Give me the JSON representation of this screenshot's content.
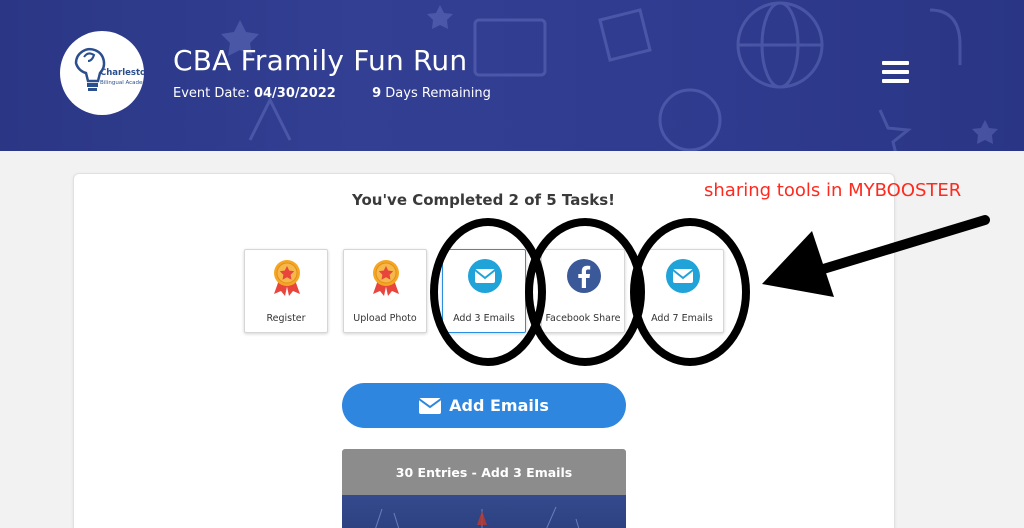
{
  "header": {
    "title": "CBA Framily Fun Run",
    "event_date_label": "Event Date:",
    "event_date": "04/30/2022",
    "days_remaining_count": "9",
    "days_remaining_label": "Days Remaining",
    "logo_text_line1": "Charleston",
    "logo_text_line2": "Bilingual Academy"
  },
  "tasks": {
    "heading": "You've Completed 2 of 5 Tasks!",
    "items": [
      {
        "label": "Register",
        "icon": "award-medal-icon",
        "completed": true
      },
      {
        "label": "Upload Photo",
        "icon": "award-medal-icon",
        "completed": true
      },
      {
        "label": "Add 3 Emails",
        "icon": "envelope-icon",
        "completed": false
      },
      {
        "label": "Facebook Share",
        "icon": "facebook-icon",
        "completed": false
      },
      {
        "label": "Add 7 Emails",
        "icon": "envelope-icon",
        "completed": false
      }
    ]
  },
  "cta": {
    "add_emails_label": "Add Emails"
  },
  "entries": {
    "label": "30 Entries - Add 3 Emails"
  },
  "annotation": {
    "text": "sharing tools in MYBOOSTER"
  },
  "colors": {
    "header_bg": "#2f3b8e",
    "primary_button": "#2e86de",
    "icon_blue": "#1fa3d8",
    "facebook_blue": "#3b5998",
    "medal_orange": "#f5a623",
    "annotation_red": "#ff2a1f"
  }
}
